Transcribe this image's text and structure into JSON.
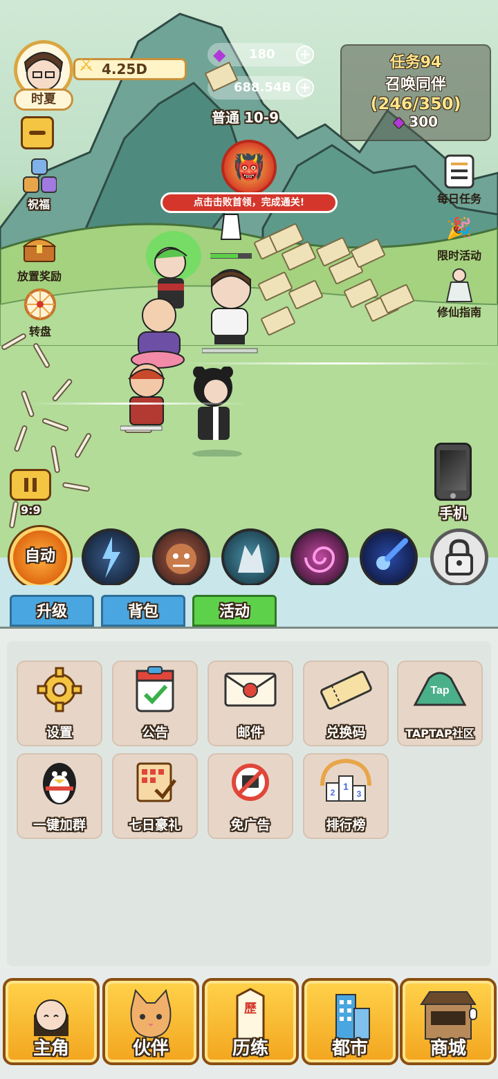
{
  "player": {
    "name": "时夏",
    "power": "4.25D"
  },
  "currency": {
    "gems": "180",
    "cash": "688.54B"
  },
  "stage": {
    "label": "普通 10-9"
  },
  "task": {
    "title": "任务94",
    "name": "召唤同伴",
    "progress": "(246/350)",
    "reward": "300"
  },
  "boss": {
    "hint": "点击击败首领，完成通关!"
  },
  "left_menu": {
    "blessing": "祝福",
    "idle_reward": "放置奖励",
    "wheel": "转盘",
    "timer": "9:9"
  },
  "right_menu": {
    "daily_task": "每日任务",
    "limited_event": "限时活动",
    "guide": "修仙指南",
    "phone": "手机"
  },
  "skills": {
    "auto": "自动"
  },
  "tabs": [
    {
      "label": "升级"
    },
    {
      "label": "背包"
    },
    {
      "label": "活动"
    }
  ],
  "activities": [
    {
      "label": "设置",
      "icon": "gear-icon"
    },
    {
      "label": "公告",
      "icon": "clipboard-icon"
    },
    {
      "label": "邮件",
      "icon": "mail-icon"
    },
    {
      "label": "兑换码",
      "icon": "ticket-icon"
    },
    {
      "label": "TAPTAP社区",
      "icon": "taptap-icon"
    },
    {
      "label": "一键加群",
      "icon": "penguin-icon"
    },
    {
      "label": "七日豪礼",
      "icon": "scroll-icon"
    },
    {
      "label": "免广告",
      "icon": "no-ads-icon"
    },
    {
      "label": "排行榜",
      "icon": "podium-icon"
    }
  ],
  "bottom_nav": [
    {
      "label": "主角"
    },
    {
      "label": "伙伴"
    },
    {
      "label": "历练",
      "badge": "歷"
    },
    {
      "label": "都市"
    },
    {
      "label": "商城"
    }
  ],
  "colors": {
    "accent": "#f3a51f",
    "active_tab": "#5ed14a",
    "tab": "#4aa6e0"
  }
}
